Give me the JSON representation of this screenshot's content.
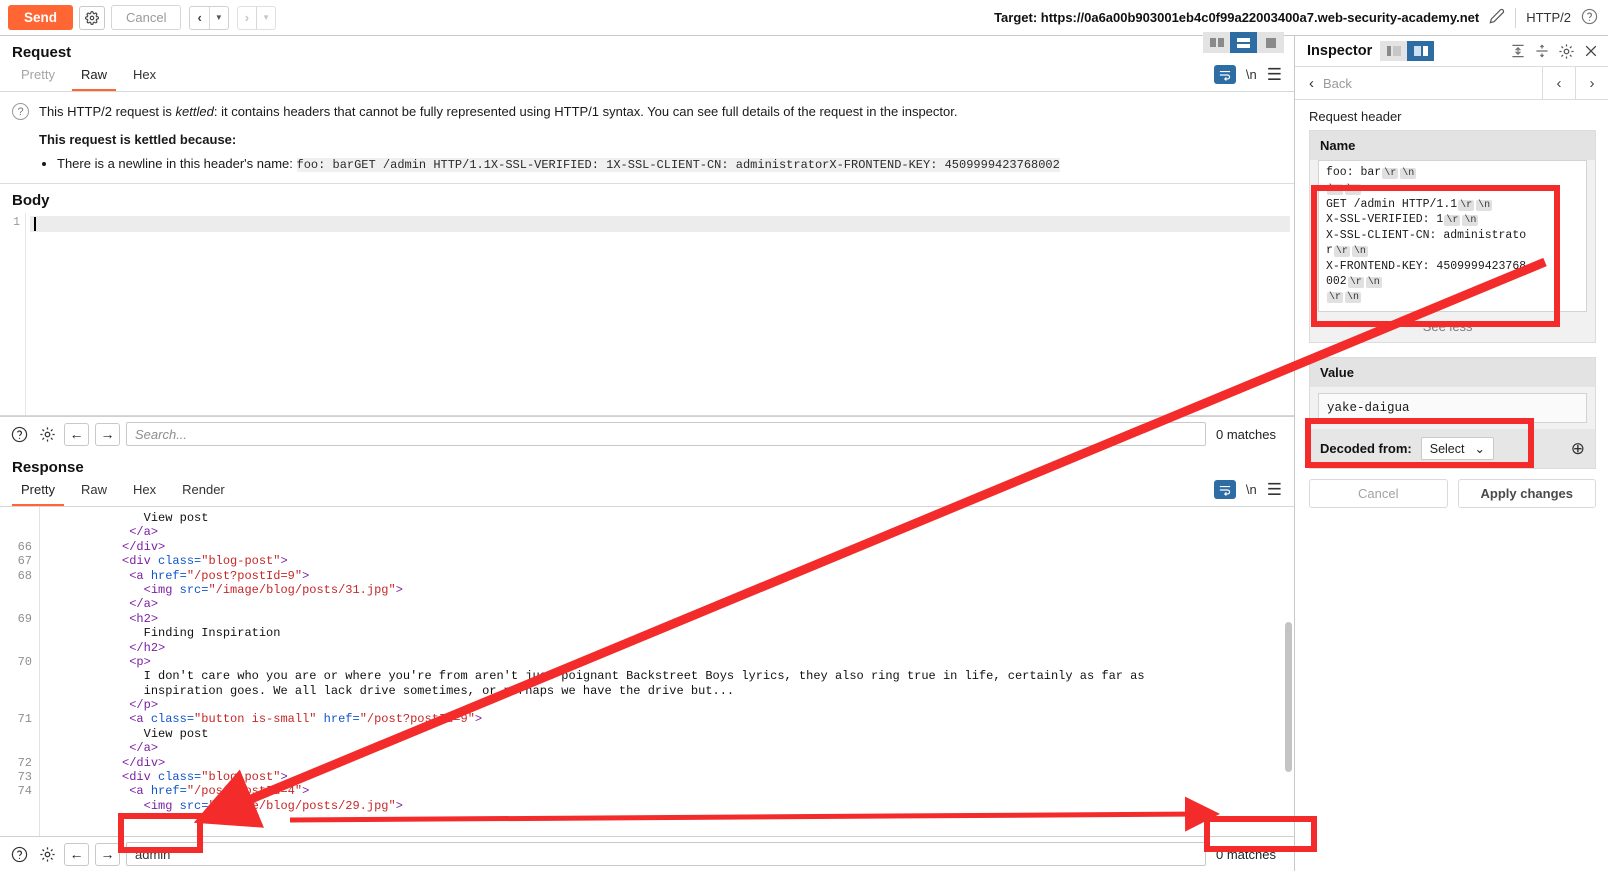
{
  "topbar": {
    "send_label": "Send",
    "settings_icon": "gear-icon",
    "cancel_label": "Cancel",
    "prev_icon": "chevron-left-icon",
    "next_icon": "chevron-right-icon",
    "caret_icon": "caret-down-icon",
    "target_label": "Target: https://0a6a00b903001eb4c0f99a22003400a7.web-security-academy.net",
    "edit_icon": "pencil-icon",
    "protocol": "HTTP/2",
    "help_icon": "question-circle-icon"
  },
  "request": {
    "title": "Request",
    "tabs": [
      {
        "label": "Pretty",
        "active": false,
        "dim": true
      },
      {
        "label": "Raw",
        "active": true,
        "dim": false
      },
      {
        "label": "Hex",
        "active": false,
        "dim": false
      }
    ],
    "newline_label": "\\n",
    "wrap_icon": "word-wrap-icon",
    "menu_icon": "hamburger-menu-icon",
    "view_toggle": [
      {
        "name": "columns-view-icon",
        "active": false
      },
      {
        "name": "rows-view-icon",
        "active": true
      },
      {
        "name": "single-view-icon",
        "active": false
      }
    ],
    "notice": {
      "icon": "question-circle-icon",
      "line1_a": "This HTTP/2 request is ",
      "line1_em": "kettled",
      "line1_b": ": it contains headers that cannot be fully represented using HTTP/1 syntax. You can see full details of the request in the inspector.",
      "heading": "This request is kettled because:",
      "bullet_prefix": "There is a newline in this header's name: ",
      "bullet_mono": "foo: barGET /admin HTTP/1.1X-SSL-VERIFIED: 1X-SSL-CLIENT-CN: administratorX-FRONTEND-KEY: 4509999423768002"
    },
    "body_label": "Body",
    "body_line_number": "1",
    "body_value": "",
    "search": {
      "help_icon": "question-circle-icon",
      "settings_icon": "gear-icon",
      "prev_icon": "arrow-left-icon",
      "next_icon": "arrow-right-icon",
      "placeholder": "Search...",
      "value": "",
      "matches": "0 matches"
    }
  },
  "response": {
    "title": "Response",
    "tabs": [
      {
        "label": "Pretty",
        "active": true
      },
      {
        "label": "Raw",
        "active": false
      },
      {
        "label": "Hex",
        "active": false
      },
      {
        "label": "Render",
        "active": false
      }
    ],
    "newline_label": "\\n",
    "wrap_icon": "word-wrap-icon",
    "menu_icon": "hamburger-menu-icon",
    "code_lines": [
      {
        "num": "",
        "indent": 13,
        "segs": [
          {
            "t": "txt",
            "s": "View post"
          }
        ]
      },
      {
        "num": "",
        "indent": 11,
        "segs": [
          {
            "t": "tag",
            "s": "</a>"
          }
        ]
      },
      {
        "num": "66",
        "indent": 10,
        "segs": [
          {
            "t": "tag",
            "s": "</div>"
          }
        ]
      },
      {
        "num": "67",
        "indent": 10,
        "segs": [
          {
            "t": "tag",
            "s": "<div "
          },
          {
            "t": "attr",
            "s": "class="
          },
          {
            "t": "val",
            "s": "\"blog-post\""
          },
          {
            "t": "tag",
            "s": ">"
          }
        ]
      },
      {
        "num": "68",
        "indent": 11,
        "segs": [
          {
            "t": "tag",
            "s": "<a "
          },
          {
            "t": "attr",
            "s": "href="
          },
          {
            "t": "val",
            "s": "\"/post?postId=9\""
          },
          {
            "t": "tag",
            "s": ">"
          }
        ]
      },
      {
        "num": "",
        "indent": 13,
        "segs": [
          {
            "t": "tag",
            "s": "<img "
          },
          {
            "t": "attr",
            "s": "src="
          },
          {
            "t": "val",
            "s": "\"/image/blog/posts/31.jpg\""
          },
          {
            "t": "tag",
            "s": ">"
          }
        ]
      },
      {
        "num": "",
        "indent": 11,
        "segs": [
          {
            "t": "tag",
            "s": "</a>"
          }
        ]
      },
      {
        "num": "69",
        "indent": 11,
        "segs": [
          {
            "t": "tag",
            "s": "<h2>"
          }
        ]
      },
      {
        "num": "",
        "indent": 13,
        "segs": [
          {
            "t": "txt",
            "s": "Finding Inspiration"
          }
        ]
      },
      {
        "num": "",
        "indent": 11,
        "segs": [
          {
            "t": "tag",
            "s": "</h2>"
          }
        ]
      },
      {
        "num": "70",
        "indent": 11,
        "segs": [
          {
            "t": "tag",
            "s": "<p>"
          }
        ]
      },
      {
        "num": "",
        "indent": 13,
        "segs": [
          {
            "t": "txt",
            "s": "I don't care who you are or where you're from aren't just poignant Backstreet Boys lyrics, they also ring true in life, certainly as far as"
          }
        ]
      },
      {
        "num": "",
        "indent": 13,
        "segs": [
          {
            "t": "txt",
            "s": "inspiration goes. We all lack drive sometimes, or perhaps we have the drive but..."
          }
        ]
      },
      {
        "num": "",
        "indent": 11,
        "segs": [
          {
            "t": "tag",
            "s": "</p>"
          }
        ]
      },
      {
        "num": "71",
        "indent": 11,
        "segs": [
          {
            "t": "tag",
            "s": "<a "
          },
          {
            "t": "attr",
            "s": "class="
          },
          {
            "t": "val",
            "s": "\"button is-small\""
          },
          {
            "t": "attr",
            "s": " href="
          },
          {
            "t": "val",
            "s": "\"/post?postId=9\""
          },
          {
            "t": "tag",
            "s": ">"
          }
        ]
      },
      {
        "num": "",
        "indent": 13,
        "segs": [
          {
            "t": "txt",
            "s": "View post"
          }
        ]
      },
      {
        "num": "",
        "indent": 11,
        "segs": [
          {
            "t": "tag",
            "s": "</a>"
          }
        ]
      },
      {
        "num": "72",
        "indent": 10,
        "segs": [
          {
            "t": "tag",
            "s": "</div>"
          }
        ]
      },
      {
        "num": "73",
        "indent": 10,
        "segs": [
          {
            "t": "tag",
            "s": "<div "
          },
          {
            "t": "attr",
            "s": "class="
          },
          {
            "t": "val",
            "s": "\"blog-post\""
          },
          {
            "t": "tag",
            "s": ">"
          }
        ]
      },
      {
        "num": "74",
        "indent": 11,
        "segs": [
          {
            "t": "tag",
            "s": "<a "
          },
          {
            "t": "attr",
            "s": "href="
          },
          {
            "t": "val",
            "s": "\"/post?postId=4\""
          },
          {
            "t": "tag",
            "s": ">"
          }
        ]
      },
      {
        "num": "",
        "indent": 13,
        "segs": [
          {
            "t": "tag",
            "s": "<img "
          },
          {
            "t": "attr",
            "s": "src="
          },
          {
            "t": "val",
            "s": "\"/image/blog/posts/29.jpg\""
          },
          {
            "t": "tag",
            "s": ">"
          }
        ]
      }
    ],
    "search": {
      "help_icon": "question-circle-icon",
      "settings_icon": "gear-icon",
      "prev_icon": "arrow-left-icon",
      "next_icon": "arrow-right-icon",
      "placeholder": "Search...",
      "value": "admin",
      "matches": "0 matches"
    }
  },
  "inspector": {
    "title": "Inspector",
    "view_toggle": [
      {
        "name": "left-split-icon",
        "active": false
      },
      {
        "name": "right-split-icon",
        "active": true
      }
    ],
    "collapse_all_icon": "collapse-all-icon",
    "expand_all_icon": "expand-all-icon",
    "settings_icon": "gear-icon",
    "close_icon": "close-icon",
    "back_icon": "chevron-left-icon",
    "back_label": "Back",
    "prev_icon": "chevron-left-icon",
    "next_icon": "chevron-right-icon",
    "section_label": "Request header",
    "name_card": {
      "title": "Name",
      "lines": [
        [
          {
            "k": "t",
            "v": "foo: bar"
          },
          {
            "k": "e",
            "v": "\\r"
          },
          {
            "k": "e",
            "v": "\\n"
          }
        ],
        [
          {
            "k": "e",
            "v": "\\r"
          },
          {
            "k": "e",
            "v": "\\n"
          }
        ],
        [
          {
            "k": "t",
            "v": "GET /admin HTTP/1.1"
          },
          {
            "k": "e",
            "v": "\\r"
          },
          {
            "k": "e",
            "v": "\\n"
          }
        ],
        [
          {
            "k": "t",
            "v": "X-SSL-VERIFIED: 1"
          },
          {
            "k": "e",
            "v": "\\r"
          },
          {
            "k": "e",
            "v": "\\n"
          }
        ],
        [
          {
            "k": "t",
            "v": "X-SSL-CLIENT-CN: administrato"
          }
        ],
        [
          {
            "k": "t",
            "v": "r"
          },
          {
            "k": "e",
            "v": "\\r"
          },
          {
            "k": "e",
            "v": "\\n"
          }
        ],
        [
          {
            "k": "t",
            "v": "X-FRONTEND-KEY: 4509999423768"
          }
        ],
        [
          {
            "k": "t",
            "v": "002"
          },
          {
            "k": "e",
            "v": "\\r"
          },
          {
            "k": "e",
            "v": "\\n"
          }
        ],
        [
          {
            "k": "e",
            "v": "\\r"
          },
          {
            "k": "e",
            "v": "\\n"
          }
        ]
      ],
      "see_less_label": "See less",
      "see_less_icon": "chevron-up-icon"
    },
    "value_card": {
      "title": "Value",
      "value": "yake-daigua",
      "decoded_label": "Decoded from:",
      "select_value": "Select",
      "select_caret": "chevron-down-icon",
      "add_icon": "plus-circle-icon"
    },
    "cancel_label": "Cancel",
    "apply_label": "Apply changes"
  },
  "annotations": {
    "highlight_color": "#f32b2b",
    "boxes": [
      {
        "name": "name-field-highlight"
      },
      {
        "name": "value-field-highlight"
      },
      {
        "name": "response-search-highlight"
      },
      {
        "name": "response-matches-highlight"
      }
    ],
    "arrows": [
      {
        "name": "arrow-name-to-search"
      },
      {
        "name": "arrow-value-to-matches"
      }
    ]
  }
}
